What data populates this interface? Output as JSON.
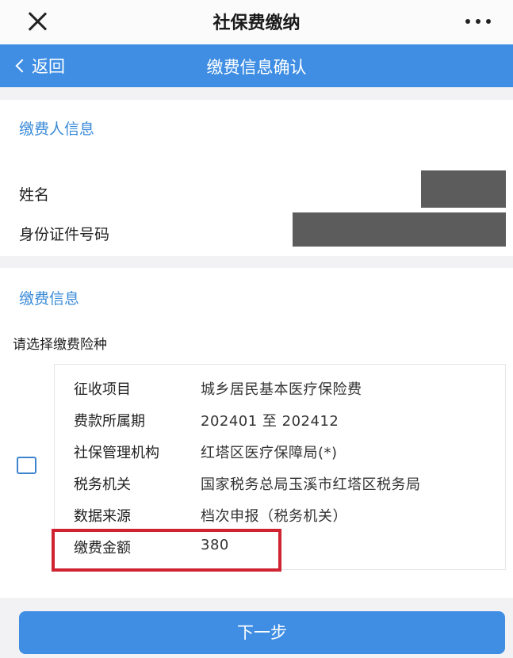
{
  "topbar": {
    "title": "社保费缴纳"
  },
  "nav": {
    "back_label": "返回",
    "title": "缴费信息确认"
  },
  "payer": {
    "section_title": "缴费人信息",
    "name_label": "姓名",
    "id_label": "身份证件号码"
  },
  "payment": {
    "section_title": "缴费信息",
    "choose_label": "请选择缴费险种",
    "rows": [
      {
        "label": "征收项目",
        "value": "城乡居民基本医疗保险费"
      },
      {
        "label": "费款所属期",
        "value": "202401 至 202412"
      },
      {
        "label": "社保管理机构",
        "value": "红塔区医疗保障局(*)"
      },
      {
        "label": "税务机关",
        "value": "国家税务总局玉溪市红塔区税务局"
      },
      {
        "label": "数据来源",
        "value": "档次申报（税务机关）"
      },
      {
        "label": "缴费金额",
        "value": "380"
      }
    ]
  },
  "next_button": {
    "label": "下一步"
  },
  "colors": {
    "accent": "#3f8ee3",
    "section_title": "#3b8bd8",
    "highlight": "#cf2332",
    "mask": "#5c5c5c"
  }
}
